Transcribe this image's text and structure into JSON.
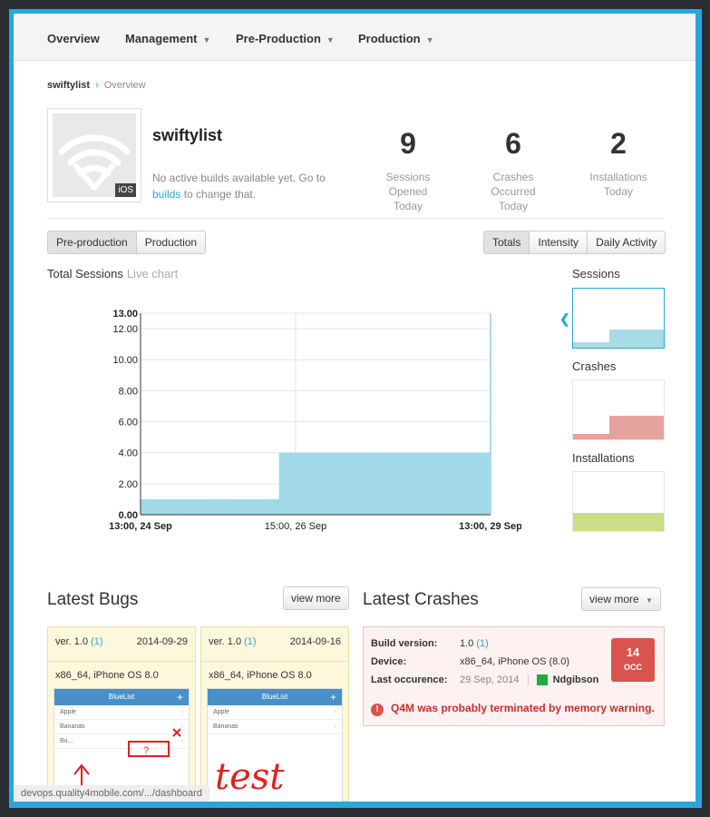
{
  "nav": {
    "items": [
      {
        "label": "Overview",
        "caret": false
      },
      {
        "label": "Management",
        "caret": true
      },
      {
        "label": "Pre-Production",
        "caret": true
      },
      {
        "label": "Production",
        "caret": true
      }
    ],
    "caret_glyph": "▼"
  },
  "breadcrumb": {
    "app": "swiftylist",
    "separator": "›",
    "current": "Overview"
  },
  "app": {
    "name": "swiftylist",
    "platform_badge": "iOS",
    "desc_pre": "No active builds available yet. Go to",
    "desc_link": "builds",
    "desc_post": "to change that.",
    "icon": "wifi-icon"
  },
  "stats": [
    {
      "value": "9",
      "label": "Sessions Opened Today"
    },
    {
      "value": "6",
      "label": "Crashes Occurred Today"
    },
    {
      "value": "2",
      "label": "Installations Today"
    }
  ],
  "env_toggle": [
    "Pre-production",
    "Production"
  ],
  "view_toggle": [
    "Totals",
    "Intensity",
    "Daily Activity"
  ],
  "chart_section": {
    "title": "Total Sessions",
    "subtitle": "Live chart"
  },
  "chart_data": {
    "type": "area",
    "title": "Total Sessions",
    "yticks": [
      "0.00",
      "2.00",
      "4.00",
      "6.00",
      "8.00",
      "10.00",
      "12.00",
      "13.00"
    ],
    "ylim": [
      0,
      13
    ],
    "xticks": [
      "13:00, 24 Sep",
      "15:00, 26 Sep",
      "13:00, 29 Sep"
    ],
    "steps": [
      {
        "x_from": "13:00, 24 Sep",
        "x_to": "~13:00, 26 Sep",
        "y": 1
      },
      {
        "x_from": "~13:00, 26 Sep",
        "x_to": "13:00, 29 Sep",
        "y": 4
      },
      {
        "x_from": "13:00, 29 Sep",
        "x_to": "13:00, 29 Sep",
        "y": 13
      }
    ],
    "color": "#a6dbe8",
    "grid": true
  },
  "side_charts": [
    {
      "label": "Sessions",
      "color": "#a6dbe8",
      "selected": true
    },
    {
      "label": "Crashes",
      "color": "#e4a49d",
      "selected": false
    },
    {
      "label": "Installations",
      "color": "#c9de86",
      "selected": false
    }
  ],
  "bugs": {
    "title": "Latest Bugs",
    "view_more": "view more",
    "items": [
      {
        "version": "ver. 1.0",
        "build": "(1)",
        "date": "2014-09-29",
        "device": "x86_64, iPhone OS 8.0",
        "screen_title": "BlueList",
        "rows": [
          "Apple",
          "Bananas",
          "Bu..."
        ],
        "annotation": "?"
      },
      {
        "version": "ver. 1.0",
        "build": "(1)",
        "date": "2014-09-16",
        "device": "x86_64, iPhone OS 8.0",
        "screen_title": "BlueList",
        "rows": [
          "Apple",
          "Bananas"
        ],
        "annotation": "test"
      }
    ]
  },
  "crashes": {
    "title": "Latest Crashes",
    "view_more": "view more",
    "item": {
      "build_label": "Build version:",
      "build_value": "1.0",
      "build_paren": "(1)",
      "device_label": "Device:",
      "device_value": "x86_64, iPhone OS (8.0)",
      "last_label": "Last occurence:",
      "last_value": "29 Sep, 2014",
      "user": "Ndgibson",
      "occ_count": "14",
      "occ_unit": "OCC",
      "message": "Q4M was probably terminated by memory warning."
    }
  },
  "status_url": "devops.quality4mobile.com/.../dashboard"
}
